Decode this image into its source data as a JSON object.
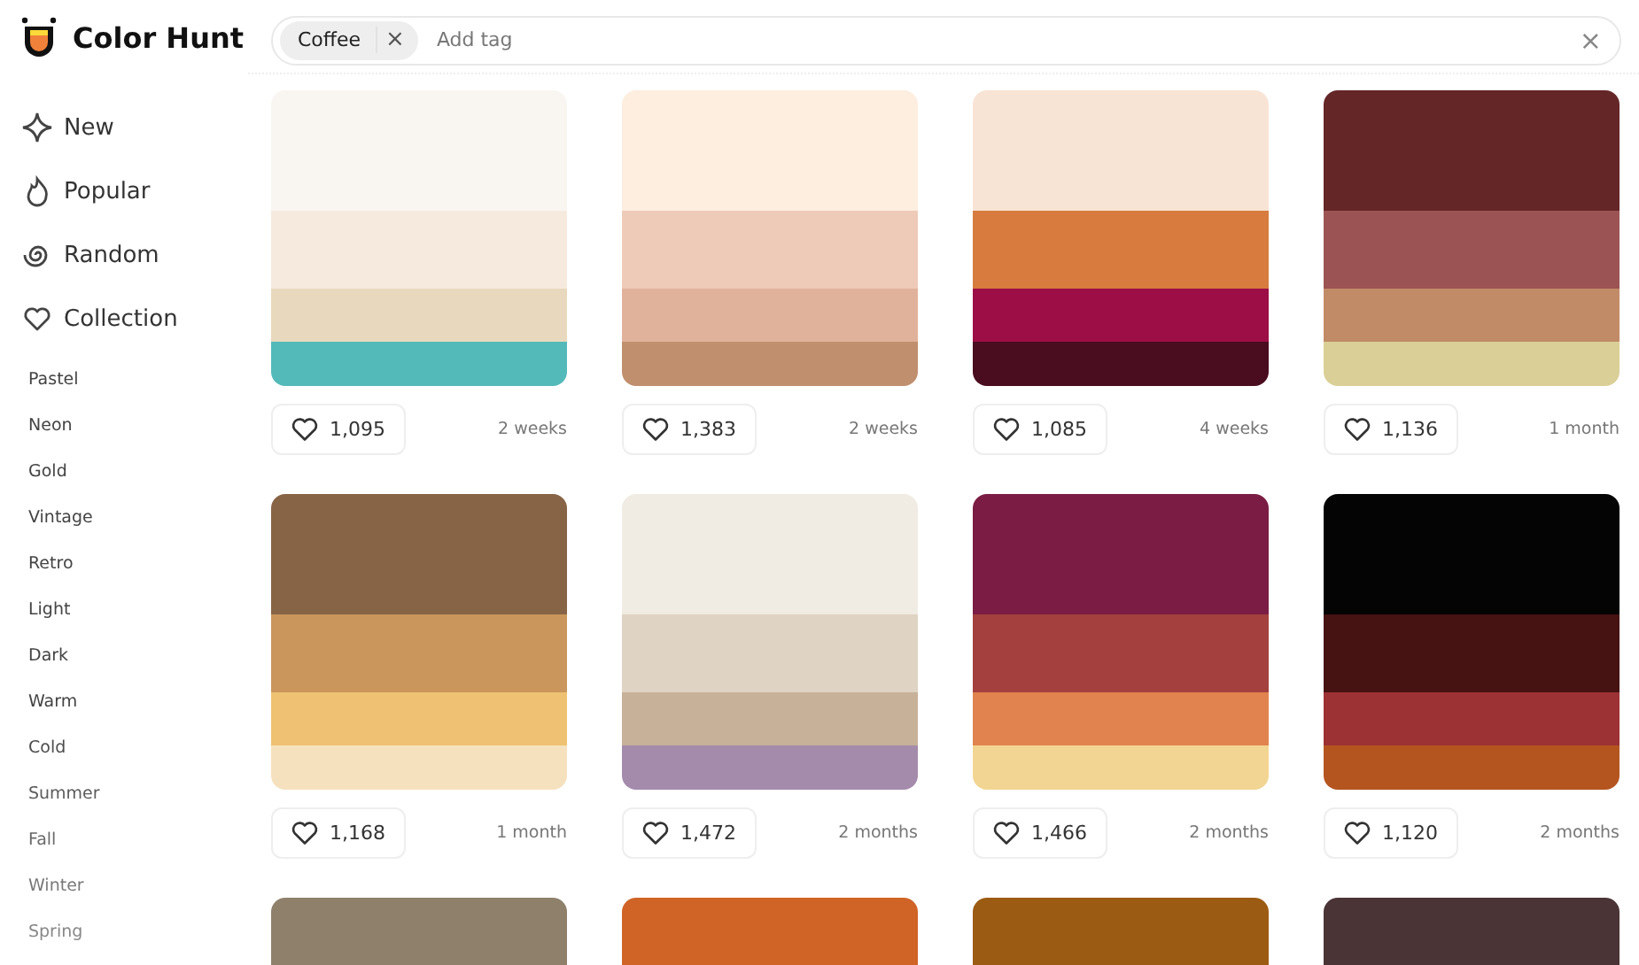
{
  "logo": {
    "title": "Color Hunt"
  },
  "search": {
    "tags": [
      {
        "label": "Coffee",
        "remove": "×"
      }
    ],
    "placeholder": "Add tag",
    "clear": "×"
  },
  "sidebar": {
    "nav": [
      {
        "label": "New",
        "kind": "new"
      },
      {
        "label": "Popular",
        "kind": "popular"
      },
      {
        "label": "Random",
        "kind": "random"
      },
      {
        "label": "Collection",
        "kind": "collection"
      }
    ],
    "tags": [
      "Pastel",
      "Neon",
      "Gold",
      "Vintage",
      "Retro",
      "Light",
      "Dark",
      "Warm",
      "Cold",
      "Summer",
      "Fall",
      "Winter",
      "Spring"
    ]
  },
  "palettes": [
    {
      "swatches": [
        {
          "color": "#f9f6f1"
        },
        {
          "color": "#f6eadf"
        },
        {
          "color": "#e8d9be"
        },
        {
          "color": "#53bab9"
        }
      ],
      "likes": "1,095",
      "time": "2 weeks"
    },
    {
      "swatches": [
        {
          "color": "#fdeedf"
        },
        {
          "color": "#edcbb8"
        },
        {
          "color": "#e1b29b"
        },
        {
          "color": "#c08f6d"
        }
      ],
      "likes": "1,383",
      "time": "2 weeks"
    },
    {
      "swatches": [
        {
          "color": "#f8e4d5"
        },
        {
          "color": "#d77c3e"
        },
        {
          "color": "#9c0e45"
        },
        {
          "color": "#4a0c1f"
        }
      ],
      "likes": "1,085",
      "time": "4 weeks"
    },
    {
      "swatches": [
        {
          "color": "#642627"
        },
        {
          "color": "#9c5354"
        },
        {
          "color": "#c18b67"
        },
        {
          "color": "#dacf97"
        }
      ],
      "likes": "1,136",
      "time": "1 month"
    },
    {
      "swatches": [
        {
          "color": "#876445"
        },
        {
          "color": "#ca965c"
        },
        {
          "color": "#eec272"
        },
        {
          "color": "#f5e1be"
        }
      ],
      "likes": "1,168",
      "time": "1 month"
    },
    {
      "swatches": [
        {
          "color": "#f0ebe3"
        },
        {
          "color": "#dfd3c3"
        },
        {
          "color": "#c7b199"
        },
        {
          "color": "#a48bab"
        }
      ],
      "likes": "1,472",
      "time": "2 months"
    },
    {
      "swatches": [
        {
          "color": "#7a1c43"
        },
        {
          "color": "#a4403e"
        },
        {
          "color": "#e0834e"
        },
        {
          "color": "#f2d592"
        }
      ],
      "likes": "1,466",
      "time": "2 months"
    },
    {
      "swatches": [
        {
          "color": "#040404"
        },
        {
          "color": "#461212"
        },
        {
          "color": "#9c3234"
        },
        {
          "color": "#b45520"
        }
      ],
      "likes": "1,120",
      "time": "2 months"
    },
    {
      "swatches": [
        {
          "color": "#8e806b"
        }
      ]
    },
    {
      "swatches": [
        {
          "color": "#d06326"
        }
      ]
    },
    {
      "swatches": [
        {
          "color": "#9c5b12"
        }
      ]
    },
    {
      "swatches": [
        {
          "color": "#4a3435"
        }
      ]
    }
  ]
}
